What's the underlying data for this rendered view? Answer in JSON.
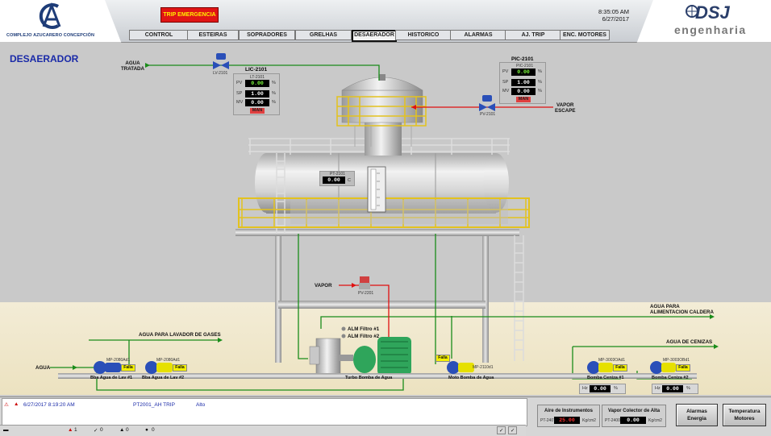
{
  "header": {
    "left_logo_text": "COMPLEJO AZUCARERO CONCEPCIÓN",
    "left_logo_mark": "CA",
    "trip_button": "TRIP EMERGENCIA",
    "time": "8:35:05 AM",
    "date": "6/27/2017",
    "right_logo": {
      "brand": "DSJ",
      "sub": "engenharia"
    },
    "tabs": [
      {
        "label": "CONTROL"
      },
      {
        "label": "ESTEIRAS"
      },
      {
        "label": "SOPRADORES"
      },
      {
        "label": "GRELHAS"
      },
      {
        "label": "DESAERADOR",
        "active": true
      },
      {
        "label": "HISTORICO"
      },
      {
        "label": "ALARMAS"
      },
      {
        "label": "AJ. TRIP"
      },
      {
        "label": "ENC. MOTORES"
      }
    ]
  },
  "page_title": "DESAERADOR",
  "labels": {
    "agua_tratada": "AGUA\nTRATADA",
    "vapor_escape": "VAPOR\nESCAPE",
    "vapor": "VAPOR",
    "agua": "AGUA",
    "agua_lavador": "AGUA PARA LAVADOR DE GASES",
    "agua_caldera": "AGUA PARA\nALIMENTACION CALDERA",
    "agua_cenizas": "AGUA DE CENIZAS",
    "alm_filtro1": "ALM Filtro #1",
    "alm_filtro2": "ALM Filtro #2",
    "turbo_bomba": "Turbo Bomba de Agua",
    "moto_bomba": "Moto Bomba de Agua",
    "bomba_lav1": "Bba Agua de Lav #1",
    "bomba_lav2": "Bba Agua de Lav #2",
    "bomba_ceniza1": "Bomba Ceniza #1",
    "bomba_ceniza2": "Bomba Ceniza #2",
    "falla": "Falla",
    "mp_2080ad1": "MP-2080Ad1",
    "mp_2080ad1b": "MP-2080Ad1",
    "mp_2110d1": "MP-2110d1",
    "mp_3003ad1": "MP-3003OAd1",
    "mp_3003bd1": "MP-3003OBd1"
  },
  "lic2101": {
    "title": "LIC-2101",
    "sub": "LT-2101",
    "pv": "0.00",
    "sp": "1.00",
    "mv": "0.00",
    "mode": "MAN",
    "unit": "%",
    "tag": "LV-2101"
  },
  "pic2101": {
    "title": "PIC-2101",
    "sub": "PIC-2101",
    "pv": "0.00",
    "sp": "1.00",
    "mv": "0.00",
    "mode": "MAN",
    "unit": "%",
    "tag": "PV-2101"
  },
  "tank_display": {
    "tag": "PT-2101",
    "value": "0.00",
    "unit": "C"
  },
  "pv2201_tag": "PV-2201",
  "ceniza1_value": "0.00",
  "ceniza2_value": "0.00",
  "ceniza_unit": "%",
  "ceniza_prefix": "Hz",
  "alarm": {
    "date": "6/27/2017 8:19:20 AM",
    "tag": "PT2001_AH TRIP",
    "state": "Alto"
  },
  "status": {
    "count1": "1",
    "count2": "0",
    "count3": "0",
    "count4": "0"
  },
  "info": {
    "aire": {
      "title": "Aire de Instrumentos",
      "value": "25.00",
      "tag": "PT-2407",
      "unit": "Kg/cm2"
    },
    "vapor_colector": {
      "title": "Vapor Colector de Alta",
      "value": "0.00",
      "tag": "PT-2400",
      "unit": "Kg/cm2"
    }
  },
  "buttons": {
    "alarmas_energia": "Alarmas\nEnergia",
    "temperatura_motores": "Temperatura\nMotores"
  },
  "colors": {
    "accent": "#1a2aa8",
    "pipe_green": "#1a8c1a",
    "pipe_red": "#e01010",
    "trip_red": "#e01515"
  }
}
